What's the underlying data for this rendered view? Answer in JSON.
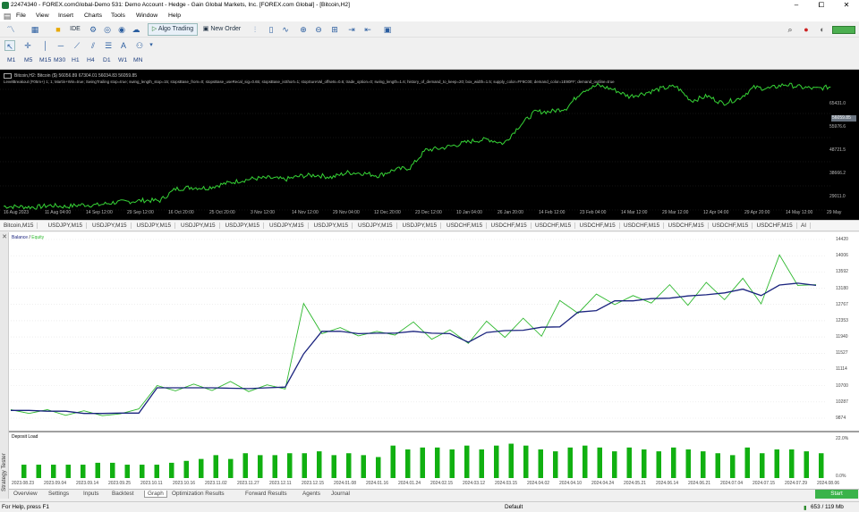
{
  "window": {
    "title": "22474340 - FOREX.comGlobal-Demo 531: Demo Account - Hedge - Gain Global Markets, Inc. [FOREX.com Global] - [Bitcoin,H2]",
    "minimize": "–",
    "maximize": "⧠",
    "close": "✕"
  },
  "menu": [
    "File",
    "View",
    "Insert",
    "Charts",
    "Tools",
    "Window",
    "Help"
  ],
  "toolbar": {
    "ide": "IDE",
    "algo_trading": "Algo Trading",
    "new_order": "New Order"
  },
  "timeframes": [
    "M1",
    "M5",
    "M15",
    "M30",
    "H1",
    "H4",
    "D1",
    "W1",
    "MN"
  ],
  "chart": {
    "symbol_line": "Bitcoin,H2: Bitcoin ($) 56056.89 67304.01 56034.83 56059.85",
    "indicator_line": "LevelBreakout (F05m+) 1; 1; Martin+Win=true; SwingTrailing stop=true; swing_length_stop=15; stopsBase_from=0; stopsBase_useRecal_sig=0.65; stopsBase_isShort=1; stopSureVal_offsets=0.6; trade_option=0; swing_length=1.6; history_of_demand_to_keep=20; box_width=1.5; supply_color=FF8C00; demand_color=1E90FF; demand_outline=true",
    "price_ticks": [
      "65431.0",
      "55976.6",
      "48721.5",
      "38666.2",
      "29011.0"
    ],
    "current_price": "56059.85",
    "date_ticks": [
      "16 Aug 2023",
      "11 Aug 04:00",
      "14 Sep 12:00",
      "29 Sep 12:00",
      "16 Oct 20:00",
      "25 Oct 20:00",
      "3 Nov 12:00",
      "14 Nov 12:00",
      "29 Nov 04:00",
      "12 Dec 20:00",
      "23 Dec 12:00",
      "10 Jan 04:00",
      "26 Jan 20:00",
      "14 Feb 12:00",
      "23 Feb 04:00",
      "14 Mar 12:00",
      "29 Mar 12:00",
      "12 Apr 04:00",
      "29 Apr 20:00",
      "14 May 12:00",
      "29 May 20:00"
    ]
  },
  "chart_tabs": [
    "Bitcoin,M15",
    "USDJPY,M15",
    "USDJPY,M15",
    "USDJPY,M15",
    "USDJPY,M15",
    "USDJPY,M15",
    "USDJPY,M15",
    "USDJPY,M15",
    "USDJPY,M15",
    "USDJPY,M15",
    "USDCHF,M15",
    "USDCHF,M15",
    "USDCHF,M15",
    "USDCHF,M15",
    "USDCHF,M15",
    "USDCHF,M15",
    "USDCHF,M15",
    "USDCHF,M15",
    "AI"
  ],
  "graph": {
    "legend_balance": "Balance",
    "legend_sep": " / ",
    "legend_equity": "Equity",
    "balance_color": "#1a237e",
    "equity_color": "#2db82d",
    "load_color": "#11b011",
    "y_ticks": [
      "14420",
      "14006",
      "13592",
      "13180",
      "12767",
      "12353",
      "11940",
      "11527",
      "11114",
      "10700",
      "10287",
      "9874"
    ],
    "depot_load_title": "Deposit Load",
    "load_ticks": [
      "22.0%",
      "0.0%"
    ],
    "x_ticks": [
      "2023.08.23",
      "2023.09.04",
      "2023.09.14",
      "2023.09.25",
      "2023.10.11",
      "2023.10.16",
      "2023.11.02",
      "2023.11.27",
      "2023.12.11",
      "2023.12.15",
      "2024.01.08",
      "2024.01.16",
      "2024.01.24",
      "2024.02.15",
      "2024.03.12",
      "2024.03.15",
      "2024.04.02",
      "2024.04.10",
      "2024.04.24",
      "2024.05.21",
      "2024.06.14",
      "2024.06.21",
      "2024.07.04",
      "2024.07.15",
      "2024.07.29",
      "2024.08.06"
    ]
  },
  "tester": {
    "side_label": "Strategy Tester",
    "tabs": [
      "Overview",
      "Settings",
      "Inputs",
      "Backtest",
      "Graph",
      "Optimization Results",
      "Forward Results",
      "Agents",
      "Journal"
    ],
    "active_tab": "Graph",
    "start": "Start"
  },
  "status": {
    "help": "For Help, press F1",
    "profile": "Default",
    "memory": "653 / 119 Mb"
  },
  "chart_data": [
    {
      "type": "line",
      "name": "Bitcoin,H2 price",
      "series": [
        {
          "name": "Bitcoin",
          "values": [
            29011,
            28900,
            28700,
            29300,
            28900,
            29500,
            29400,
            30200,
            30500,
            30900,
            30800,
            34500,
            35000,
            34800,
            36000,
            37000,
            37800,
            38000,
            37500,
            38600,
            38900,
            38200,
            39700,
            39500,
            38700,
            40600,
            41200,
            46800,
            47400,
            48500,
            49700,
            50200,
            48900,
            54500,
            58900,
            59000,
            60100,
            65500,
            67300,
            66000,
            63800,
            64800,
            66200,
            67000,
            62400,
            63900,
            61600,
            63000,
            66600,
            66300,
            67600,
            66700,
            66200,
            66900
          ]
        }
      ]
    },
    {
      "type": "line",
      "title": "Balance / Equity",
      "ylim": [
        9674,
        14420
      ],
      "series": [
        {
          "name": "Balance",
          "values": [
            9880,
            9880,
            9860,
            9860,
            9800,
            9800,
            9810,
            9810,
            10480,
            10480,
            10480,
            10480,
            10470,
            10460,
            10480,
            10500,
            11380,
            11980,
            11980,
            11920,
            11930,
            11930,
            11980,
            11930,
            11920,
            11690,
            11950,
            12000,
            12010,
            12090,
            12100,
            12490,
            12530,
            12790,
            12790,
            12850,
            12860,
            12920,
            12950,
            13000,
            13100,
            12930,
            13210,
            13260,
            13200
          ]
        },
        {
          "name": "Equity",
          "values": [
            9900,
            9800,
            9900,
            9750,
            9870,
            9740,
            9790,
            9920,
            10540,
            10400,
            10580,
            10410,
            10650,
            10380,
            10560,
            10450,
            12720,
            11920,
            12080,
            11860,
            11980,
            11880,
            12230,
            11770,
            12020,
            11660,
            12250,
            11820,
            12330,
            11850,
            12800,
            12460,
            12970,
            12690,
            12930,
            12730,
            13220,
            12670,
            13280,
            12820,
            13390,
            12710,
            14010,
            13200,
            13220
          ]
        }
      ]
    },
    {
      "type": "bar",
      "title": "Deposit Load",
      "ylim": [
        0,
        22
      ],
      "values": [
        7,
        7,
        7,
        7,
        7,
        8,
        8,
        7,
        7,
        7,
        8,
        9,
        10,
        12,
        10,
        13,
        12,
        12,
        13,
        13,
        14,
        12,
        13,
        12,
        11,
        17,
        15,
        16,
        16,
        15,
        17,
        15,
        17,
        18,
        17,
        15,
        14,
        16,
        17,
        16,
        14,
        16,
        15,
        14,
        16,
        15,
        14,
        13,
        12,
        16,
        13,
        15,
        15,
        14,
        13
      ]
    }
  ]
}
